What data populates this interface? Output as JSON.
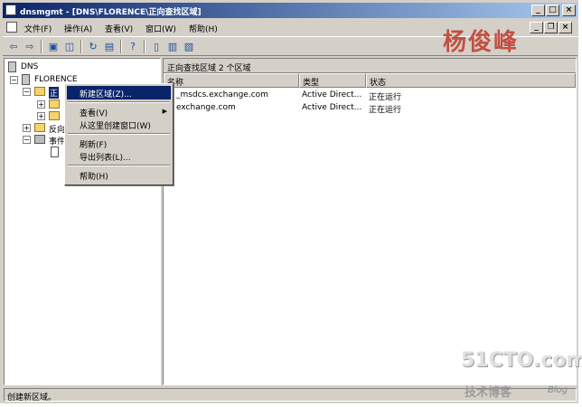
{
  "window": {
    "title": "dnsmgmt - [DNS\\FLORENCE\\正向查找区域]",
    "min": "_",
    "max": "□",
    "close": "×"
  },
  "menubar": {
    "items": [
      "文件(F)",
      "操作(A)",
      "查看(V)",
      "窗口(W)",
      "帮助(H)"
    ]
  },
  "watermark": {
    "name": "杨俊峰",
    "site": "51CTO.com",
    "site_sub": "技术博客",
    "blog": "Blog"
  },
  "tree": {
    "root": "DNS",
    "server": "FLORENCE",
    "forward_zone_fragment": "正",
    "reverse_zone_fragment": "反向",
    "events_fragment": "事件"
  },
  "right": {
    "header": "正向查找区域   2 个区域",
    "columns": [
      "名称",
      "类型",
      "状态"
    ],
    "rows": [
      {
        "name": "_msdcs.exchange.com",
        "type": "Active Direct...",
        "status": "正在运行"
      },
      {
        "name": "exchange.com",
        "type": "Active Direct...",
        "status": "正在运行"
      }
    ]
  },
  "context_menu": {
    "items": [
      "新建区域(Z)...",
      "查看(V)",
      "从这里创建窗口(W)",
      "刷新(F)",
      "导出列表(L)...",
      "帮助(H)"
    ]
  },
  "status": {
    "text": "创建新区域。"
  }
}
